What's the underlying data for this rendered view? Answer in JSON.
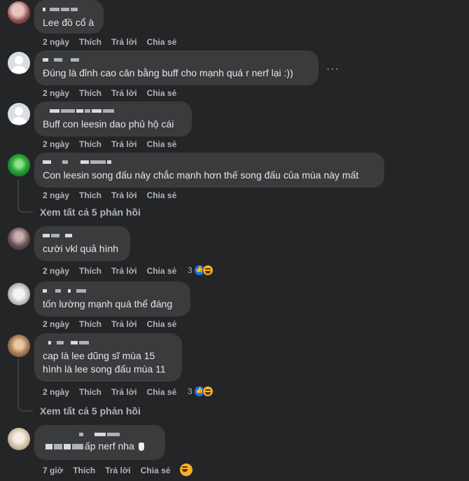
{
  "ui": {
    "like_label": "Thích",
    "reply_label": "Trả lời",
    "share_label": "Chia sẻ",
    "more_options_label": "···",
    "view_replies_label": "Xem tất cả 5 phản hồi"
  },
  "comments": [
    {
      "time": "2 ngày",
      "text": "Lee đồ cổ à",
      "reaction_count": null
    },
    {
      "time": "2 ngày",
      "text": "Đúng là đỉnh cao cân bằng buff cho mạnh quá r nerf lại :))",
      "reaction_count": null
    },
    {
      "time": "2 ngày",
      "text": "Buff con leesin dao phủ hộ cái",
      "reaction_count": null
    },
    {
      "time": "2 ngày",
      "text": "Con leesin song đấu này chắc mạnh hơn thế song đấu của mùa này mất",
      "reaction_count": null
    },
    {
      "time": "2 ngày",
      "text": "cười vkl quả hình",
      "reaction_count": "3"
    },
    {
      "time": "2 ngày",
      "text": "tốn lường mạnh quá thể đáng",
      "reaction_count": null
    },
    {
      "time": "2 ngày",
      "text": "cap là lee dũng sĩ mùa 15\nhình là lee song đấu mùa 11",
      "reaction_count": "3"
    },
    {
      "time": "7 giờ",
      "text": "ấp nerf nha",
      "reaction_count": null
    }
  ],
  "colors": {
    "background": "#242526",
    "bubble": "#3a3b3c",
    "text": "#e4e6eb",
    "secondary_text": "#b0b3b8",
    "like_blue": "#1877f2",
    "haha_yellow": "#f7b125"
  }
}
